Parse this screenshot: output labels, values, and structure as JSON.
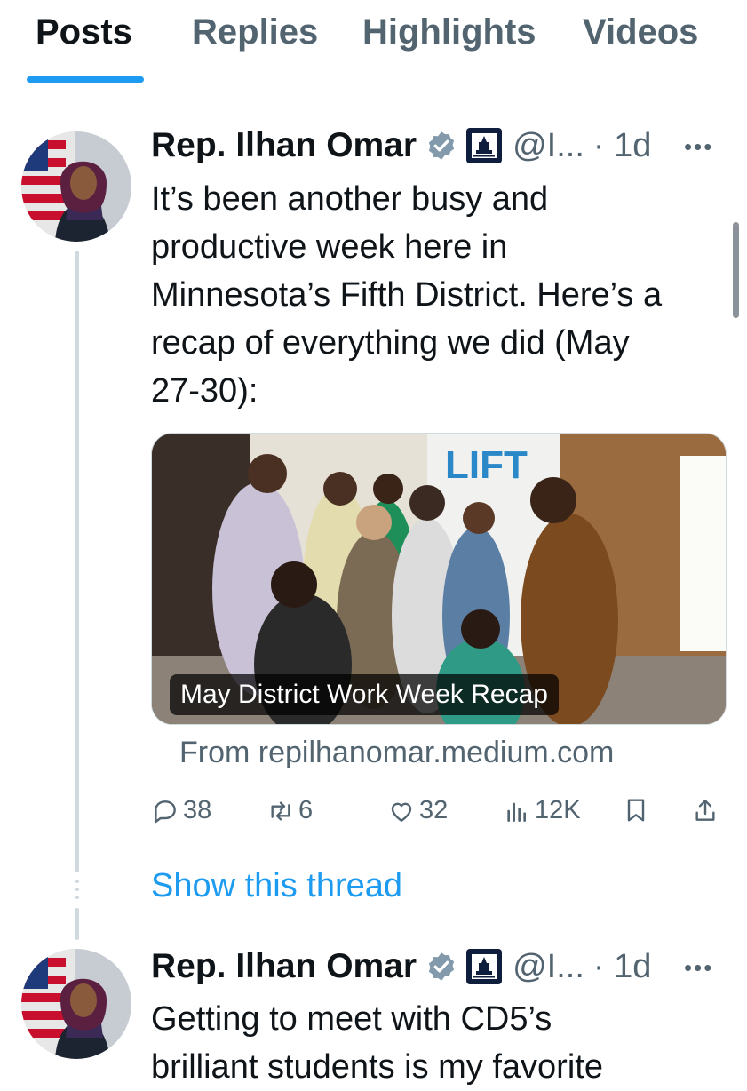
{
  "tabs": [
    {
      "label": "Posts",
      "active": true
    },
    {
      "label": "Replies",
      "active": false
    },
    {
      "label": "Highlights",
      "active": false
    },
    {
      "label": "Videos",
      "active": false
    }
  ],
  "posts": [
    {
      "author": "Rep. Ilhan Omar",
      "handle": "@I...",
      "time": "· 1d",
      "text": "It’s been another busy and\nproductive week here in\nMinnesota’s Fifth District. Here’s a\nrecap of everything we did (May\n27-30):",
      "card": {
        "caption": "May District Work Week Recap",
        "source": "From repilhanomar.medium.com"
      },
      "stats": {
        "replies": "38",
        "reposts": "6",
        "likes": "32",
        "views": "12K"
      },
      "show_thread": "Show this thread"
    },
    {
      "author": "Rep. Ilhan Omar",
      "handle": "@I...",
      "time": "· 1d",
      "text": "Getting to meet with CD5’s\nbrilliant students is my favorite"
    }
  ],
  "more_label": "•••",
  "colors": {
    "accent": "#1d9bf0",
    "muted": "#536471",
    "text": "#0f1419"
  },
  "icons": [
    "verified-badge-icon",
    "capitol-badge-icon",
    "more-icon",
    "reply-icon",
    "repost-icon",
    "like-icon",
    "views-icon",
    "bookmark-icon",
    "share-icon"
  ]
}
